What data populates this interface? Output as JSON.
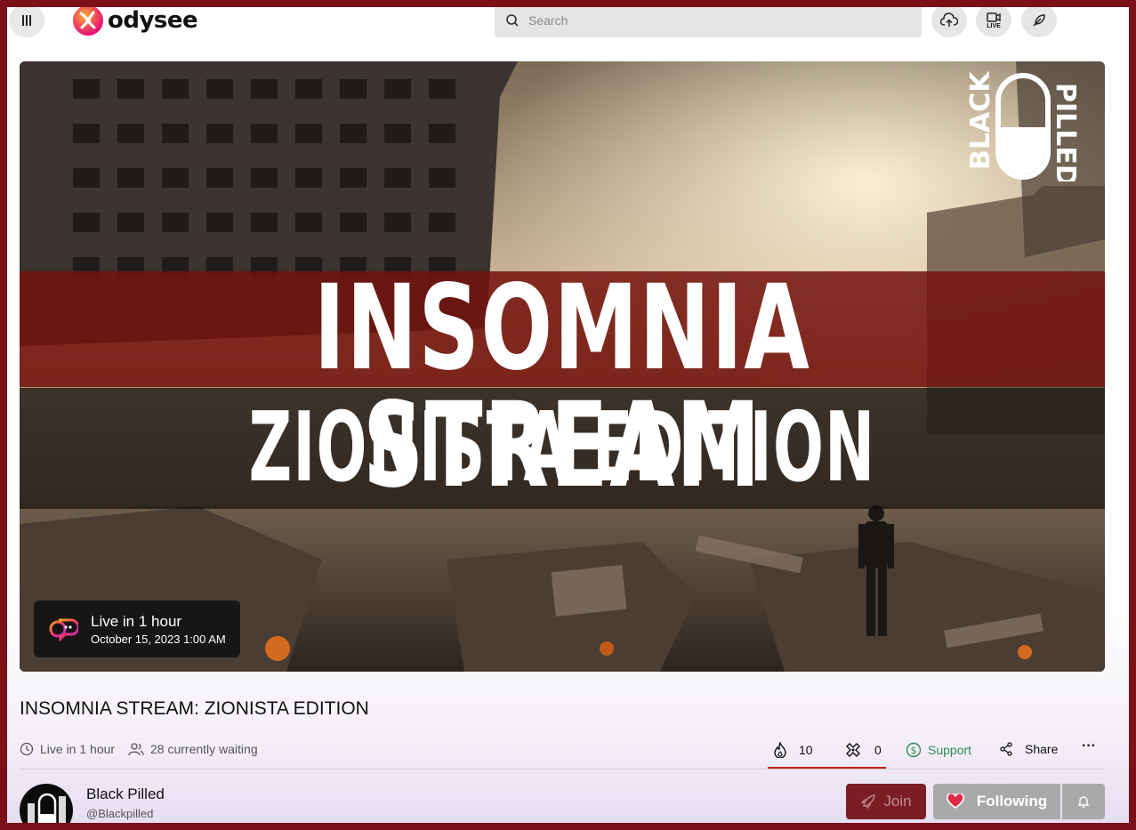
{
  "header": {
    "logo_text": "odysee",
    "search_placeholder": "Search",
    "live_label": "LIVE"
  },
  "thumbnail": {
    "line1": "INSOMNIA STREAM",
    "line2": "ZIONISTA EDITION",
    "brand_word1": "BLACK",
    "brand_word2": "PILLED",
    "live_badge": {
      "main": "Live in 1 hour",
      "sub": "October 15, 2023 1:00 AM"
    }
  },
  "video": {
    "title": "INSOMNIA STREAM: ZIONISTA EDITION",
    "live_status": "Live in 1 hour",
    "waiting": "28 currently waiting"
  },
  "actions": {
    "fire_count": "10",
    "slime_count": "0",
    "support_label": "Support",
    "share_label": "Share",
    "more_label": "···"
  },
  "channel": {
    "name": "Black Pilled",
    "handle": "@Blackpilled",
    "join_label": "Join",
    "following_label": "Following"
  },
  "colors": {
    "accent_red": "#c4211d",
    "support_green": "#2e8b57",
    "join_bg": "#7a1d24",
    "frame": "#7a1018"
  }
}
